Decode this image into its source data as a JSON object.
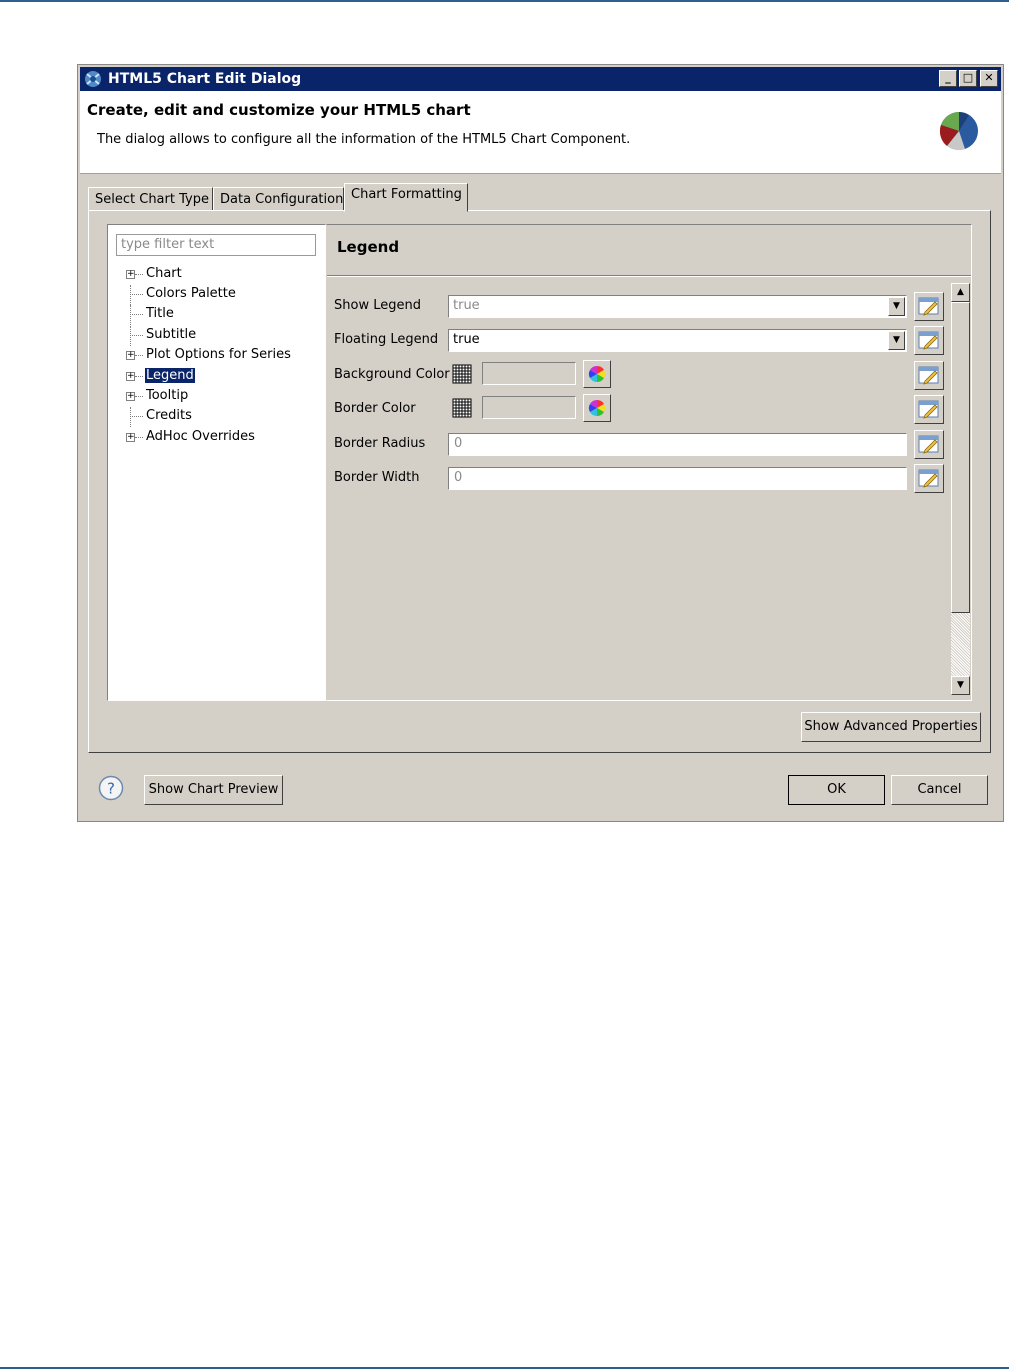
{
  "dialog": {
    "title": "HTML5 Chart Edit Dialog",
    "window_buttons": {
      "minimize": "_",
      "maximize": "□",
      "close": "✕"
    },
    "header_title": "Create, edit and customize your HTML5 chart",
    "header_description": "The dialog allows to configure all the information of the HTML5 Chart Component."
  },
  "tabs": [
    {
      "label": "Select Chart Type",
      "active": false
    },
    {
      "label": "Data Configuration",
      "active": false
    },
    {
      "label": "Chart Formatting",
      "active": true
    }
  ],
  "tree": {
    "filter_placeholder": "type filter text",
    "items": [
      {
        "label": "Chart",
        "expandable": true,
        "selected": false
      },
      {
        "label": "Colors Palette",
        "expandable": false,
        "selected": false
      },
      {
        "label": "Title",
        "expandable": false,
        "selected": false
      },
      {
        "label": "Subtitle",
        "expandable": false,
        "selected": false
      },
      {
        "label": "Plot Options for Series",
        "expandable": true,
        "selected": false
      },
      {
        "label": "Legend",
        "expandable": true,
        "selected": true
      },
      {
        "label": "Tooltip",
        "expandable": true,
        "selected": false
      },
      {
        "label": "Credits",
        "expandable": false,
        "selected": false
      },
      {
        "label": "AdHoc Overrides",
        "expandable": true,
        "selected": false
      }
    ]
  },
  "section": {
    "title": "Legend",
    "properties": [
      {
        "label": "Show Legend",
        "type": "combo",
        "value": "true",
        "disabled": true
      },
      {
        "label": "Floating Legend",
        "type": "combo",
        "value": "true",
        "disabled": false
      },
      {
        "label": "Background Color",
        "type": "color",
        "value": ""
      },
      {
        "label": "Border Color",
        "type": "color",
        "value": ""
      },
      {
        "label": "Border Radius",
        "type": "text",
        "value": "0"
      },
      {
        "label": "Border Width",
        "type": "text",
        "value": "0"
      }
    ]
  },
  "buttons": {
    "advanced": "Show Advanced Properties",
    "preview": "Show Chart Preview",
    "ok": "OK",
    "cancel": "Cancel"
  },
  "icons": {
    "app": "chart-app-icon",
    "header": "pie-chart-icon",
    "help": "help-icon",
    "edit": "edit-pencil-icon",
    "grid": "grid-icon",
    "wheel": "color-wheel-icon"
  },
  "colors": {
    "titlebar": "#0a246a",
    "dialog_bg": "#d4d0c8",
    "selection": "#0a246a"
  }
}
